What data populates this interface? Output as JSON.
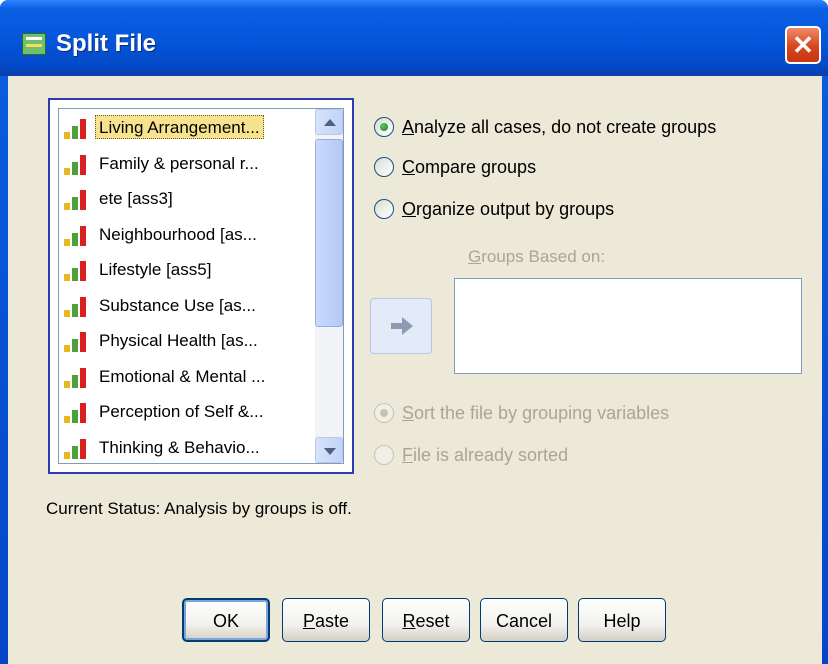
{
  "window": {
    "title": "Split File",
    "close_symbol": "✕"
  },
  "variables": [
    {
      "label": "Living Arrangement...",
      "selected": true
    },
    {
      "label": "Family & personal r..."
    },
    {
      "label": "ete [ass3]"
    },
    {
      "label": "Neighbourhood [as..."
    },
    {
      "label": "Lifestyle [ass5]"
    },
    {
      "label": "Substance Use [as..."
    },
    {
      "label": "Physical Health [as..."
    },
    {
      "label": "Emotional & Mental ..."
    },
    {
      "label": "Perception of Self &..."
    },
    {
      "label": "Thinking & Behavio..."
    }
  ],
  "options": {
    "analyze_all": {
      "mnemonic": "A",
      "rest": "nalyze all cases, do not create groups",
      "checked": true
    },
    "compare": {
      "mnemonic": "C",
      "rest": "ompare groups",
      "checked": false
    },
    "organize": {
      "mnemonic": "O",
      "rest": "rganize output by groups",
      "checked": false
    }
  },
  "groups_based_on": {
    "mnemonic": "G",
    "rest": "roups Based on:"
  },
  "sort_options": {
    "sort": {
      "mnemonic": "S",
      "rest": "ort the file by grouping variables",
      "checked": true
    },
    "sorted": {
      "mnemonic": "F",
      "rest": "ile is already sorted",
      "checked": false
    }
  },
  "status": "Current Status: Analysis by groups is off.",
  "buttons": {
    "ok": "OK",
    "paste": {
      "mnemonic": "P",
      "rest": "aste"
    },
    "reset": {
      "mnemonic": "R",
      "rest": "eset"
    },
    "cancel": "Cancel",
    "help": "Help"
  },
  "colors": {
    "titlebar": "#0656dc",
    "dialog_bg": "#ece9d8",
    "selection": "#f7e38e",
    "bar_red": "#d82020",
    "bar_green": "#4f9f3a",
    "bar_yellow": "#e8b820"
  }
}
